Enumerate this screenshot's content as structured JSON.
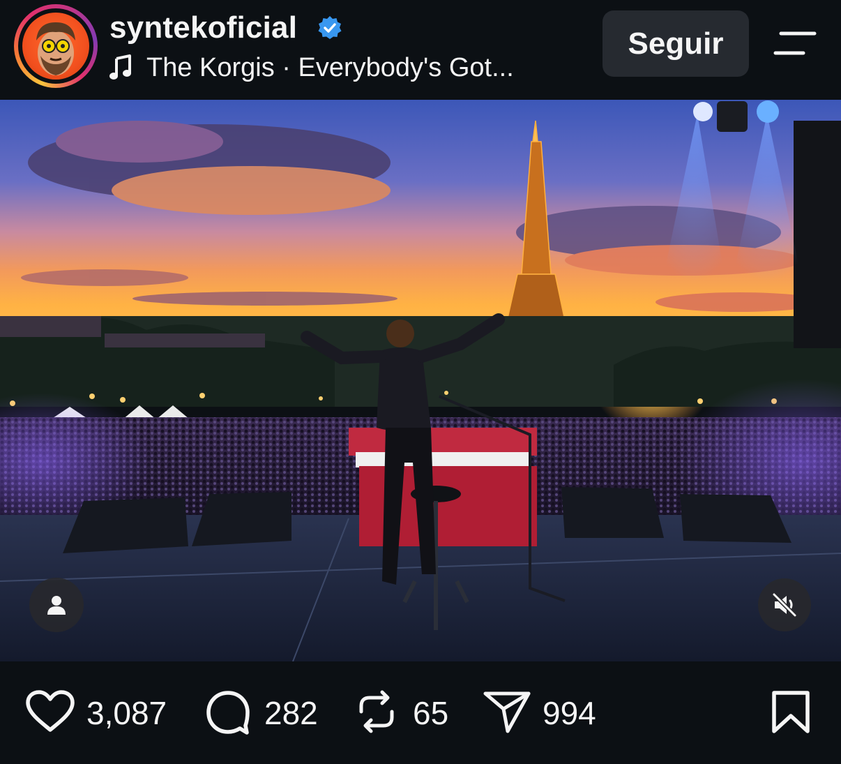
{
  "post": {
    "username": "syntekoficial",
    "verified": true,
    "music": {
      "icon": "music-note-icon",
      "text": "The Korgis · Everybody's Got..."
    },
    "follow_label": "Seguir",
    "menu_icon": "menu-icon"
  },
  "media": {
    "description_icons": [
      "user-tag-icon",
      "muted-speaker-icon"
    ]
  },
  "actions": {
    "likes": "3,087",
    "comments": "282",
    "reposts": "65",
    "shares": "994",
    "icons": [
      "heart-icon",
      "comment-icon",
      "repost-icon",
      "share-icon",
      "bookmark-icon"
    ]
  },
  "colors": {
    "background": "#0c1014",
    "button": "#262a30",
    "verified": "#3897f0",
    "text": "#f5f5f5"
  }
}
